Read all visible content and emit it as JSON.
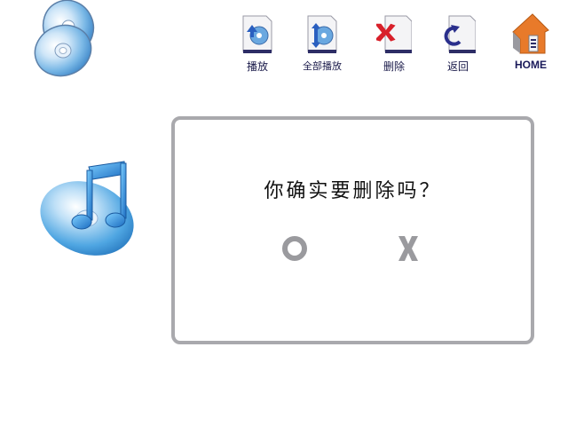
{
  "toolbar": {
    "play_label": "播放",
    "play_all_label": "全部播放",
    "delete_label": "删除",
    "back_label": "返回",
    "home_label": "HOME"
  },
  "dialog": {
    "message": "你确实要删除吗？",
    "confirm_icon": "circle-icon",
    "cancel_icon": "x-icon"
  },
  "colors": {
    "dialog_border": "#a9a9ad",
    "disc_blue": "#3aa0e0",
    "delete_red": "#d8202a",
    "home_orange": "#e87a2a",
    "label_navy": "#1a1a4a"
  }
}
